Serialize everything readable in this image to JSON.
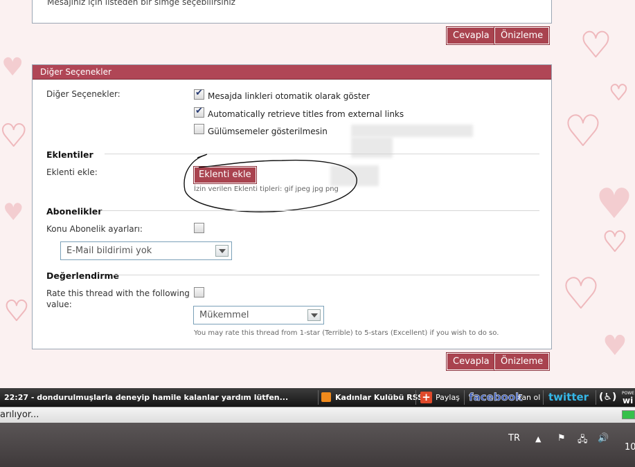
{
  "top_panel": {
    "hint": "Mesajınız için listeden bir simge seçebilirsiniz"
  },
  "buttons": {
    "reply": "Cevapla",
    "preview": "Önizleme"
  },
  "options": {
    "header": "Diğer Seçenekler",
    "label": "Diğer Seçenekler:",
    "checkboxes": [
      {
        "label": "Mesajda linkleri otomatik olarak göster",
        "checked": true
      },
      {
        "label": "Automatically retrieve titles from external links",
        "checked": true
      },
      {
        "label": "Gülümsemeler gösterilmesin",
        "checked": false
      }
    ]
  },
  "attachments": {
    "title": "Eklentiler",
    "label": "Eklenti ekle:",
    "button": "Eklenti ekle",
    "allowed": "İzin verilen Eklenti tipleri: gif jpeg jpg png"
  },
  "subscriptions": {
    "title": "Abonelikler",
    "label": "Konu Abonelik ayarları:",
    "select_value": "E-Mail bildirimi yok"
  },
  "rating": {
    "title": "Değerlendirme",
    "label_line1": "Rate this thread with the following",
    "label_line2": "value:",
    "select_value": "Mükemmel",
    "note": "You may rate this thread from 1-star (Terrible) to 5-stars (Excellent) if you wish to do so."
  },
  "ticker": {
    "news": "22:27 - dondurulmuşlarla deneyip hamile kalanlar yardım lütfen...",
    "rss": "Kadınlar Kulübü RSS",
    "share": "Paylaş",
    "facebook": "facebook",
    "fan": "Fan ol",
    "twitter": "twitter",
    "powered_top": "POWE",
    "powered_bottom": "wi"
  },
  "statusbar": {
    "text": "arılıyor..."
  },
  "windows_taskbar": {
    "lang": "TR",
    "clock": "10"
  },
  "colors": {
    "accent": "#a9434f",
    "header": "#b04656"
  }
}
